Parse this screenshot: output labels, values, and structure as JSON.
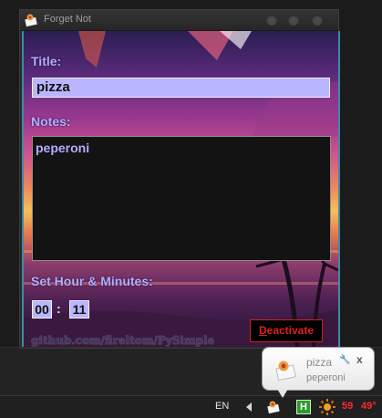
{
  "window": {
    "title": "Forget Not",
    "title_label": "Title:",
    "title_value": "pizza",
    "notes_label": "Notes:",
    "notes_value": "peperoni",
    "time_label": "Set Hour & Minutes:",
    "hour": "00",
    "colon": ":",
    "minute": "11",
    "deactivate_first": "D",
    "deactivate_rest": "eactivate",
    "footer": "github.com/fireltom/PySimple"
  },
  "notification": {
    "title": "pizza",
    "body": "peperoni",
    "close": "x",
    "wrench": "🔧"
  },
  "taskbar": {
    "language": "EN",
    "tray_h": "H",
    "cpu": "59",
    "temp": "49°"
  },
  "colors": {
    "label": "#b3acff",
    "input_bg": "#b9b6ff",
    "deactivate": "#e02020",
    "accent_border": "#3d8aa6"
  }
}
